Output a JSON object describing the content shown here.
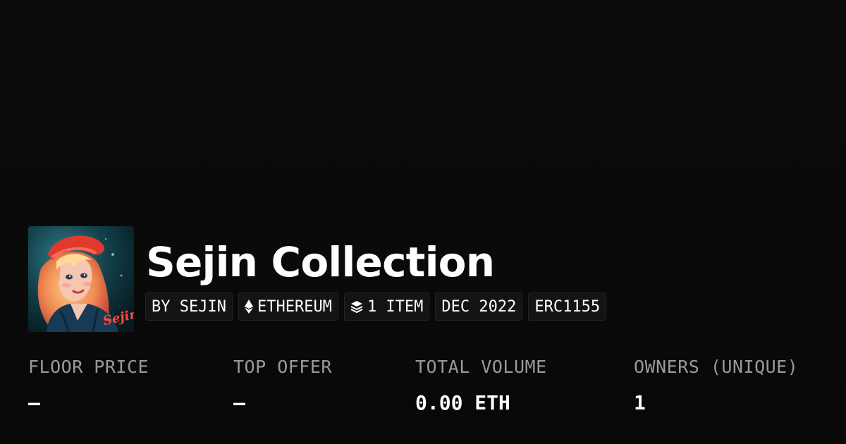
{
  "collection": {
    "name": "Sejin Collection",
    "avatar_signature": "Sejin"
  },
  "tags": {
    "creator": "BY SEJIN",
    "chain": "ETHEREUM",
    "chain_icon": "ethereum-icon",
    "items": "1 ITEM",
    "items_icon": "layers-icon",
    "date": "DEC 2022",
    "standard": "ERC1155"
  },
  "stats": {
    "floor_price": {
      "label": "FLOOR PRICE",
      "value": "–"
    },
    "top_offer": {
      "label": "TOP OFFER",
      "value": "–"
    },
    "total_volume": {
      "label": "TOTAL VOLUME",
      "value": "0.00 ETH"
    },
    "owners": {
      "label": "OWNERS (UNIQUE)",
      "value": "1"
    }
  },
  "colors": {
    "background": "#0a0a0a",
    "text": "#ffffff",
    "muted_label": "#9a9a9a",
    "tag_background": "#141414"
  }
}
